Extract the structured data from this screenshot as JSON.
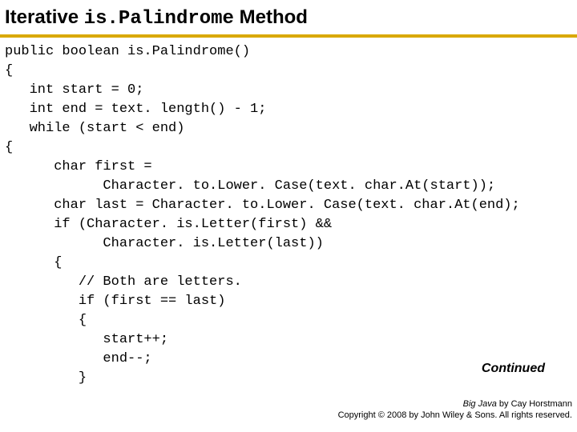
{
  "title": {
    "pre": "Iterative ",
    "code": "is.Palindrome",
    "post": " Method"
  },
  "code": "public boolean is.Palindrome()\n{\n   int start = 0;\n   int end = text. length() - 1;\n   while (start < end)\n{\n      char first =\n            Character. to.Lower. Case(text. char.At(start));\n      char last = Character. to.Lower. Case(text. char.At(end);\n      if (Character. is.Letter(first) &&\n            Character. is.Letter(last))\n      {\n         // Both are letters.\n         if (first == last)\n         {\n            start++;\n            end--;\n         }",
  "continued": "Continued",
  "credit": {
    "line1_it": "Big Java",
    "line1_rest": " by  Cay Horstmann",
    "line2": "Copyright © 2008 by John Wiley & Sons.  All rights reserved."
  }
}
